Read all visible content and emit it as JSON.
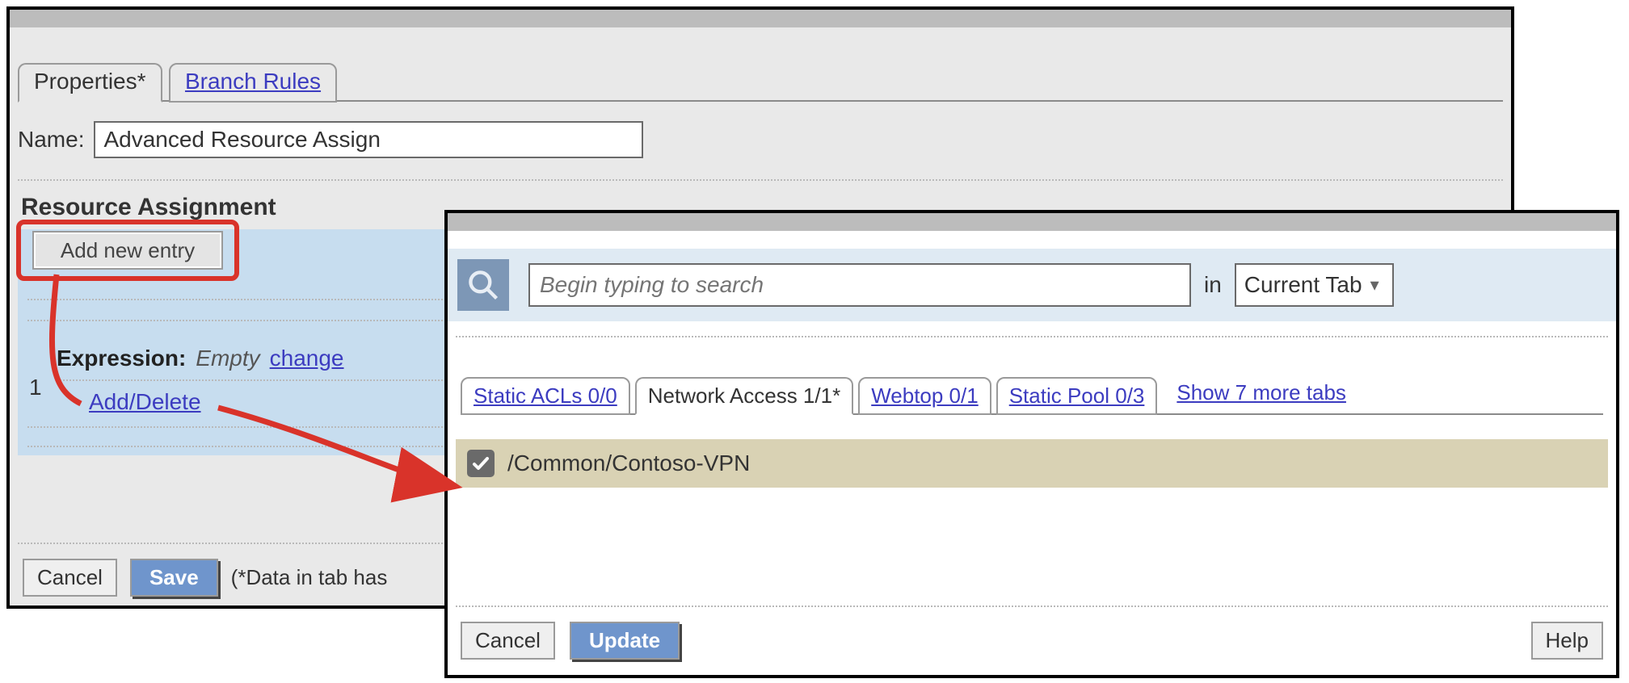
{
  "leftPanel": {
    "tabs": {
      "properties": "Properties*",
      "branchRules": "Branch Rules"
    },
    "nameLabel": "Name:",
    "nameValue": "Advanced Resource Assign",
    "sectionTitle": "Resource Assignment",
    "addNewEntry": "Add new entry",
    "rowIndex": "1",
    "expression": {
      "label": "Expression",
      "value": "Empty",
      "changeLink": "change"
    },
    "addDeleteLink": "Add/Delete",
    "footer": {
      "cancel": "Cancel",
      "save": "Save",
      "hint": "(*Data in tab has"
    }
  },
  "rightPanel": {
    "search": {
      "placeholder": "Begin typing to search",
      "inLabel": "in",
      "scope": "Current Tab"
    },
    "subTabs": {
      "staticAcls": "Static ACLs 0/0",
      "networkAccess": "Network Access 1/1*",
      "webtop": "Webtop 0/1",
      "staticPool": "Static Pool 0/3",
      "more": "Show 7 more tabs"
    },
    "item": {
      "checked": true,
      "label": "/Common/Contoso-VPN"
    },
    "footer": {
      "cancel": "Cancel",
      "update": "Update",
      "help": "Help"
    }
  }
}
